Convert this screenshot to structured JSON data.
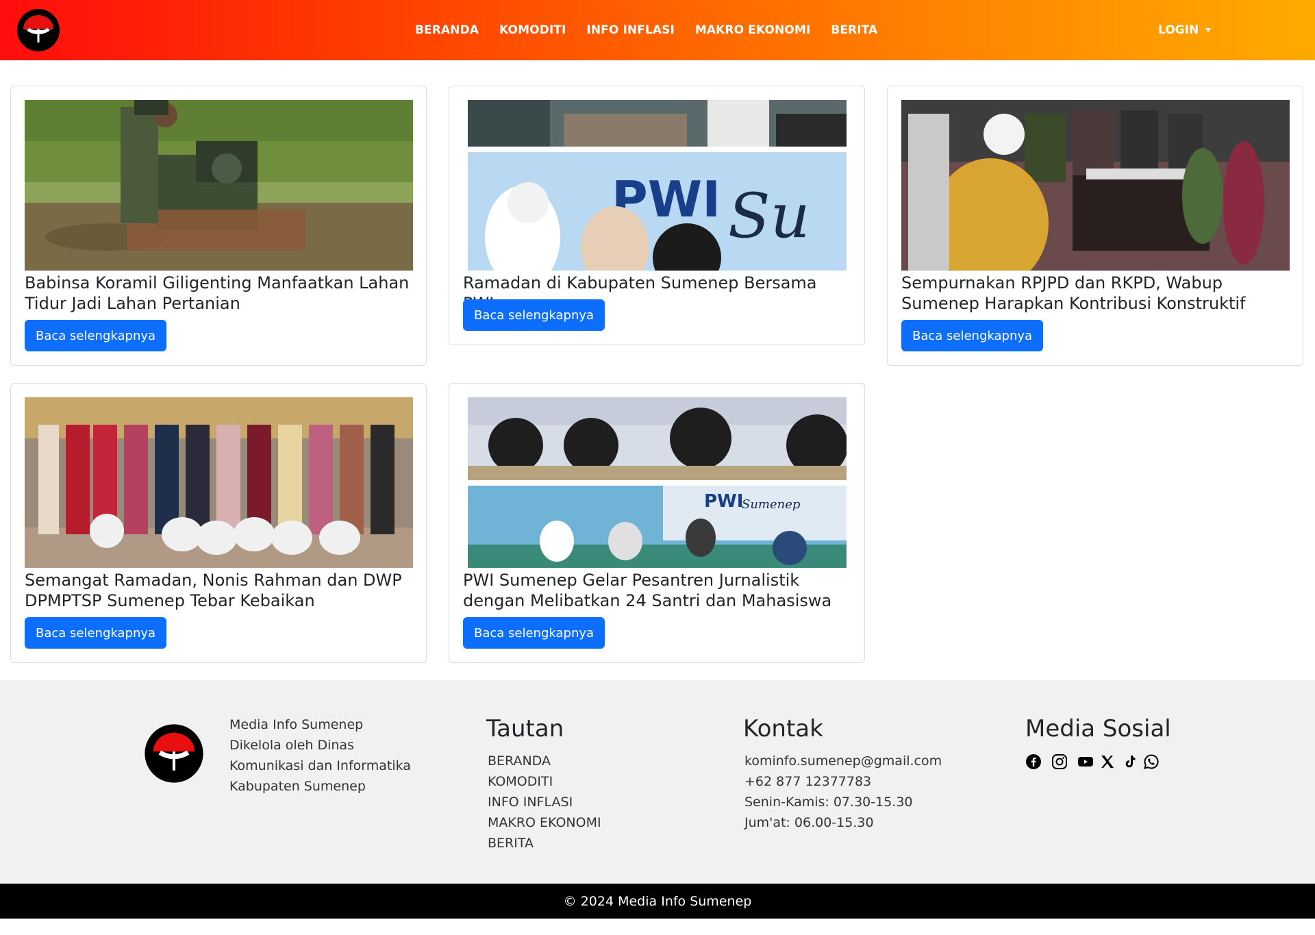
{
  "brand": {
    "logo_icon": "umbrella-logo-icon",
    "colors": {
      "primary": "#0d6efd",
      "header_start": "#ff0d0d",
      "header_end": "#ffaa00"
    }
  },
  "nav": {
    "items": [
      "BERANDA",
      "KOMODITI",
      "INFO INFLASI",
      "MAKRO EKONOMI",
      "BERITA"
    ],
    "login_label": "LOGIN"
  },
  "news": [
    {
      "title": "Babinsa Koramil Giligenting Manfaatkan Lahan Tidur Jadi Lahan Pertanian",
      "button": "Baca selengkapnya"
    },
    {
      "title": "Ramadan di Kabupaten Sumenep Bersama PWI",
      "button": "Baca selengkapnya"
    },
    {
      "title": "Sempurnakan RPJPD dan RKPD, Wabup Sumenep Harapkan Kontribusi Konstruktif",
      "button": "Baca selengkapnya"
    },
    {
      "title": "Semangat Ramadan, Nonis Rahman dan DWP DPMPTSP Sumenep Tebar Kebaikan",
      "button": "Baca selengkapnya"
    },
    {
      "title": "PWI Sumenep Gelar Pesantren Jurnalistik dengan Melibatkan 24 Santri dan Mahasiswa",
      "button": "Baca selengkapnya"
    }
  ],
  "footer": {
    "about": [
      "Media Info Sumenep",
      "Dikelola oleh Dinas",
      "Komunikasi dan Informatika",
      "Kabupaten Sumenep"
    ],
    "links_heading": "Tautan",
    "links": [
      "BERANDA",
      "KOMODITI",
      "INFO INFLASI",
      "MAKRO EKONOMI",
      "BERITA"
    ],
    "contact_heading": "Kontak",
    "contact": {
      "email": "kominfo.sumenep@gmail.com",
      "phone": "+62 877 12377783",
      "hours_weekday": "Senin-Kamis: 07.30-15.30",
      "hours_friday": "Jum'at: 06.00-15.30"
    },
    "social_heading": "Media Sosial",
    "social_icons": [
      "facebook-icon",
      "instagram-icon",
      "youtube-icon",
      "x-icon",
      "tiktok-icon",
      "whatsapp-icon"
    ],
    "copyright": "© 2024 Media Info Sumenep"
  }
}
